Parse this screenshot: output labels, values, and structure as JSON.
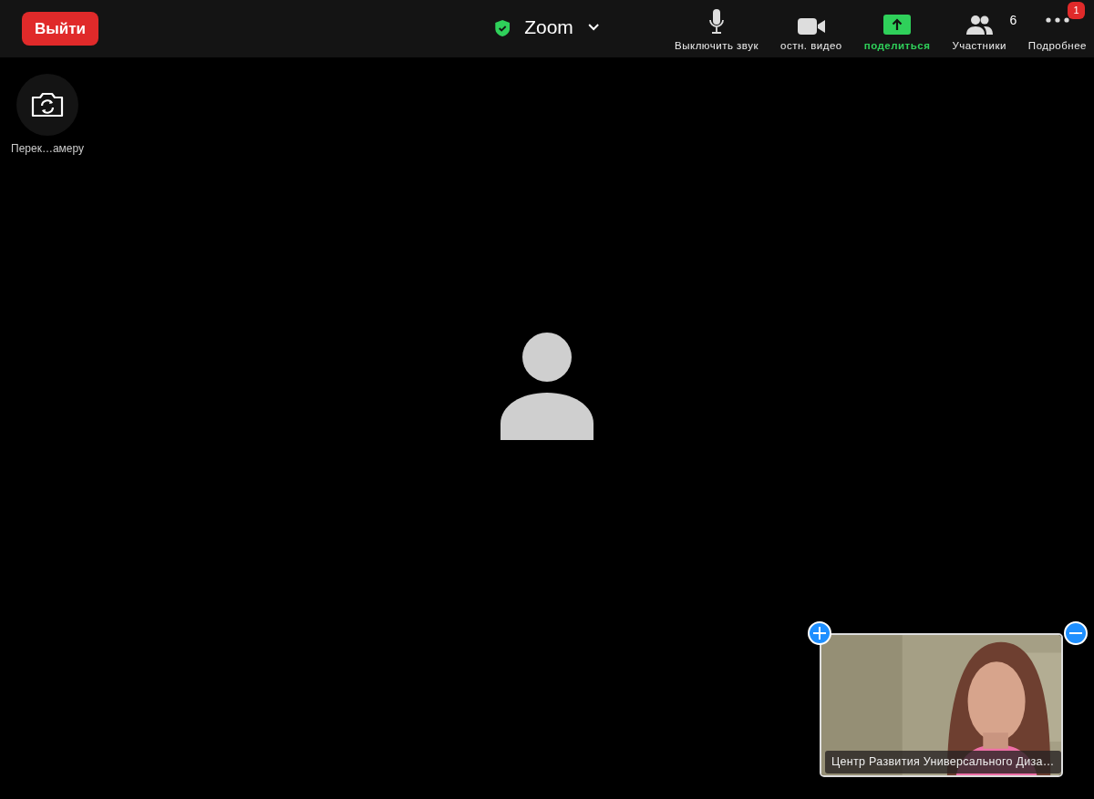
{
  "leave_button": {
    "label": "Выйти"
  },
  "meeting": {
    "title": "Zoom",
    "secure": true
  },
  "toolbar": [
    {
      "kind": "mic",
      "label": "Выключить звук"
    },
    {
      "kind": "video",
      "label": "остн. видео"
    },
    {
      "kind": "share",
      "label": "поделиться"
    },
    {
      "kind": "participants",
      "label": "Участники",
      "count": "6"
    },
    {
      "kind": "more",
      "label": "Подробнее",
      "badge": "1"
    }
  ],
  "camera_switch": {
    "label": "Перек…амеру"
  },
  "self_view": {
    "kind": "picture",
    "name": "Центр Развития Универсального Диза…"
  }
}
